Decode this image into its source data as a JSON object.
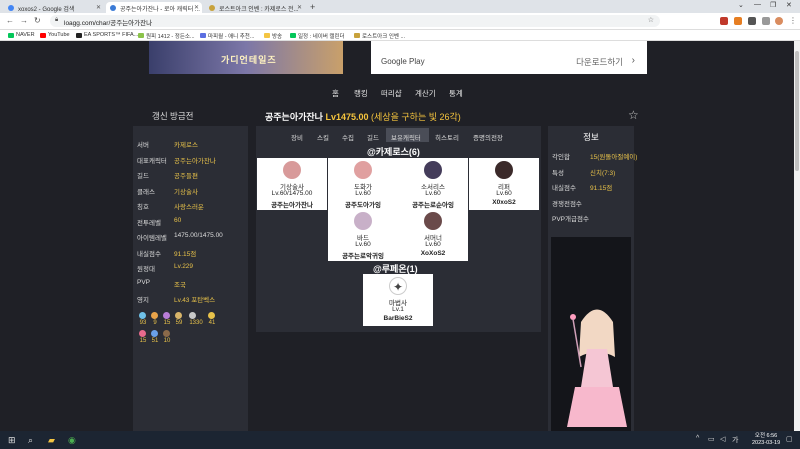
{
  "browser": {
    "tabs": [
      {
        "title": "xoxos2 - Google 검색",
        "color": "#4285f4"
      },
      {
        "title": "공주는아가잔나 - 로아 캐릭터 ...",
        "color": "#3b7bd6"
      },
      {
        "title": "로스트아크 인벤 : 카제로스 전...",
        "color": "#c8a23c"
      }
    ],
    "new_tab": "+",
    "url": "loagg.com/char/공주는아가잔나",
    "bookmarks": [
      {
        "label": "NAVER",
        "color": "#03c75a"
      },
      {
        "label": "YouTube",
        "color": "#ff0000"
      },
      {
        "label": "EA SPORTS™ FIFA...",
        "color": "#222222"
      },
      {
        "label": "원피 1412 - 정든소...",
        "color": "#8bc34a"
      },
      {
        "label": "마피월 - 애니 추천...",
        "color": "#5b6ee1"
      },
      {
        "label": "방송",
        "color": "#f4c542"
      },
      {
        "label": "일정 : 네이버 캘린더",
        "color": "#03c75a"
      },
      {
        "label": "로스트아크 인벤 ...",
        "color": "#c8a23c"
      }
    ]
  },
  "ad": {
    "banner_logo": "가디언테일즈",
    "store": "Google Play",
    "download": "다운로드하기"
  },
  "nav": [
    "홈",
    "랭킹",
    "떠리샵",
    "계산기",
    "통계"
  ],
  "header": {
    "update_label": "갱신 방금전",
    "char_name": "공주는아가잔나",
    "char_level": "Lv1475.00",
    "char_rank": "(세상을 구하는 빛 26각)"
  },
  "profile": {
    "rows": [
      {
        "label": "서버",
        "value": "카제로스",
        "gold": true
      },
      {
        "label": "대표캐릭터",
        "value": "공주는아가잔나",
        "gold": true
      },
      {
        "label": "길드",
        "value": "공주들편",
        "gold": true
      },
      {
        "label": "클래스",
        "value": "기상술사",
        "gold": true
      },
      {
        "label": "칭호",
        "value": "사랑스러운",
        "gold": true
      },
      {
        "label": "전투레벨",
        "value": "60",
        "gold": true
      },
      {
        "label": "아이템레벨",
        "value": "1475.00/1475.00",
        "gold": false
      },
      {
        "label": "내실점수",
        "value": "91.15점",
        "gold": true
      },
      {
        "label": "원정대",
        "value": "Lv.229",
        "gold": true
      },
      {
        "label": "PVP",
        "value": "조국",
        "gold": true
      },
      {
        "label": "영지",
        "value": "Lv.43 포탄벡스",
        "gold": true
      }
    ],
    "gems_row1": [
      {
        "value": "93",
        "color": "#6fc1e8"
      },
      {
        "value": "9",
        "color": "#e8a34a"
      },
      {
        "value": "15",
        "color": "#b87cd6"
      },
      {
        "value": "59",
        "color": "#d8b56a"
      },
      {
        "value": "1330",
        "color": "#c9c9c9"
      },
      {
        "value": "41",
        "color": "#e8c24a"
      }
    ],
    "gems_row2": [
      {
        "value": "15",
        "color": "#e86a8c"
      },
      {
        "value": "51",
        "color": "#6aa0e8"
      },
      {
        "value": "10",
        "color": "#8b6a4a"
      }
    ]
  },
  "tabs": [
    "장비",
    "스킬",
    "수집",
    "길드",
    "보유캐릭터",
    "히스토리",
    "증명의전장"
  ],
  "servers": [
    {
      "name": "@카제로스(6)"
    },
    {
      "name": "@루페온(1)"
    }
  ],
  "characters": [
    {
      "class": "기상술사",
      "level": "Lv.60/1475.00",
      "name": "공주는아가잔나",
      "avatar": "#d89a9a"
    },
    {
      "class": "도화가",
      "level": "Lv.60",
      "name": "공주도아가잉",
      "avatar": "#e0a0a0"
    },
    {
      "class": "소서리스",
      "level": "Lv.60",
      "name": "공주는로순아잉",
      "avatar": "#443c5a"
    },
    {
      "class": "리퍼",
      "level": "Lv.60",
      "name": "X0xoS2",
      "avatar": "#3b2a2a"
    },
    {
      "class": "바드",
      "level": "Lv.60",
      "name": "공주는로악귀잉",
      "avatar": "#c8b0c8"
    },
    {
      "class": "서머너",
      "level": "Lv.60",
      "name": "XoXoS2",
      "avatar": "#6a4a4a"
    },
    {
      "class": "마법사",
      "level": "Lv.1",
      "name": "BarBieS2",
      "avatar": "#ffffff"
    }
  ],
  "info": {
    "title": "정보",
    "rows": [
      {
        "label": "각인합",
        "value": "15(원돌아절예이)"
      },
      {
        "label": "특성",
        "value": "신치(7:3)"
      },
      {
        "label": "내실점수",
        "value": "91.15점"
      },
      {
        "label": "경쟁전점수",
        "value": ""
      },
      {
        "label": "PVP개급점수",
        "value": ""
      }
    ]
  },
  "taskbar": {
    "time": "오전 6:56",
    "date": "2023-03-19"
  }
}
